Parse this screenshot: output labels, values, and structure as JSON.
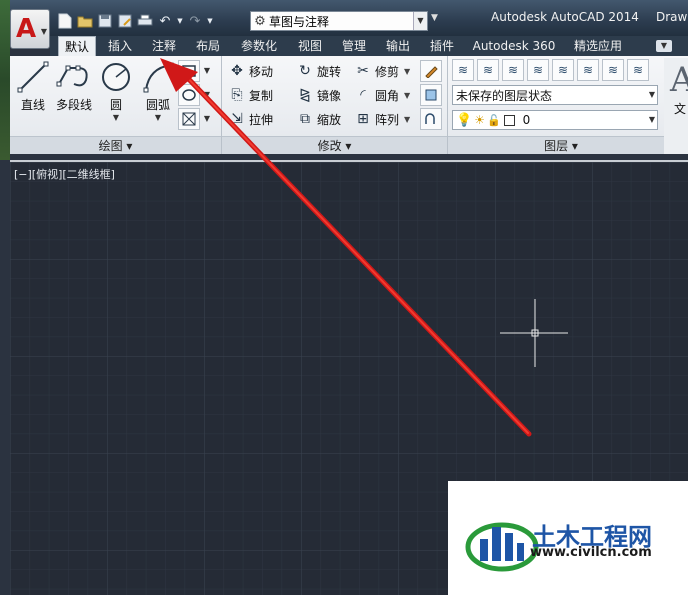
{
  "app": {
    "title": "Autodesk AutoCAD 2014",
    "title_extra": "Draw",
    "logo_letter": "A",
    "workspace": "草图与注释"
  },
  "quick_access": [
    "new-icon",
    "open-icon",
    "save-icon",
    "save-as-icon",
    "plot-icon",
    "undo-icon",
    "redo-icon"
  ],
  "tabs": [
    "默认",
    "插入",
    "注释",
    "布局",
    "参数化",
    "视图",
    "管理",
    "输出",
    "插件",
    "Autodesk 360",
    "精选应用"
  ],
  "active_tab": "默认",
  "panels": {
    "draw": {
      "title": "绘图",
      "tools": [
        "直线",
        "多段线",
        "圆",
        "圆弧"
      ]
    },
    "modify": {
      "title": "修改",
      "tools": [
        "移动",
        "旋转",
        "修剪",
        "复制",
        "镜像",
        "圆角",
        "拉伸",
        "缩放",
        "阵列"
      ]
    },
    "layers": {
      "title": "图层",
      "layer_state": "未保存的图层状态",
      "current_layer": "0"
    },
    "annotation": {
      "label": "文"
    }
  },
  "viewport": {
    "label": "[−][俯视][二维线框]"
  },
  "watermark": {
    "name": "土木工程网",
    "url": "www.civilcn.com"
  },
  "colors": {
    "canvas": "#252b36",
    "grid": "#323a47",
    "arrow": "#d01818",
    "brand": "#1e55a6"
  }
}
